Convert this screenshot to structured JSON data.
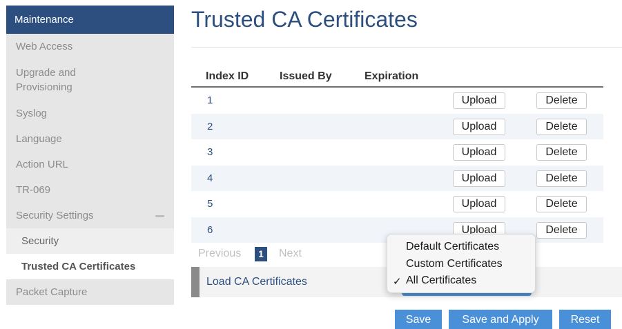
{
  "sidebar": {
    "header": "Maintenance",
    "items": {
      "web_access": "Web Access",
      "upgrade": "Upgrade and\nProvisioning",
      "syslog": "Syslog",
      "language": "Language",
      "action_url": "Action URL",
      "tr069": "TR-069",
      "security_settings": "Security Settings",
      "packet_capture": "Packet Capture"
    },
    "sub_items": {
      "security": "Security",
      "trusted_ca": "Trusted CA Certificates"
    }
  },
  "page": {
    "title": "Trusted CA Certificates"
  },
  "table": {
    "headers": {
      "index": "Index ID",
      "issued_by": "Issued By",
      "expiration": "Expiration"
    },
    "rows": [
      {
        "index": "1",
        "issued_by": "",
        "expiration": ""
      },
      {
        "index": "2",
        "issued_by": "",
        "expiration": ""
      },
      {
        "index": "3",
        "issued_by": "",
        "expiration": ""
      },
      {
        "index": "4",
        "issued_by": "",
        "expiration": ""
      },
      {
        "index": "5",
        "issued_by": "",
        "expiration": ""
      },
      {
        "index": "6",
        "issued_by": "",
        "expiration": ""
      }
    ],
    "upload_label": "Upload",
    "delete_label": "Delete"
  },
  "pager": {
    "previous": "Previous",
    "current_page": "1",
    "next": "Next"
  },
  "load": {
    "label": "Load CA Certificates",
    "options": [
      "Default Certificates",
      "Custom Certificates",
      "All Certificates"
    ],
    "selected": "All Certificates",
    "check_mark": "✓"
  },
  "actions": {
    "save": "Save",
    "save_apply": "Save and Apply",
    "reset": "Reset"
  },
  "colors": {
    "brand": "#2c4f7f",
    "accent": "#4a90d9"
  }
}
